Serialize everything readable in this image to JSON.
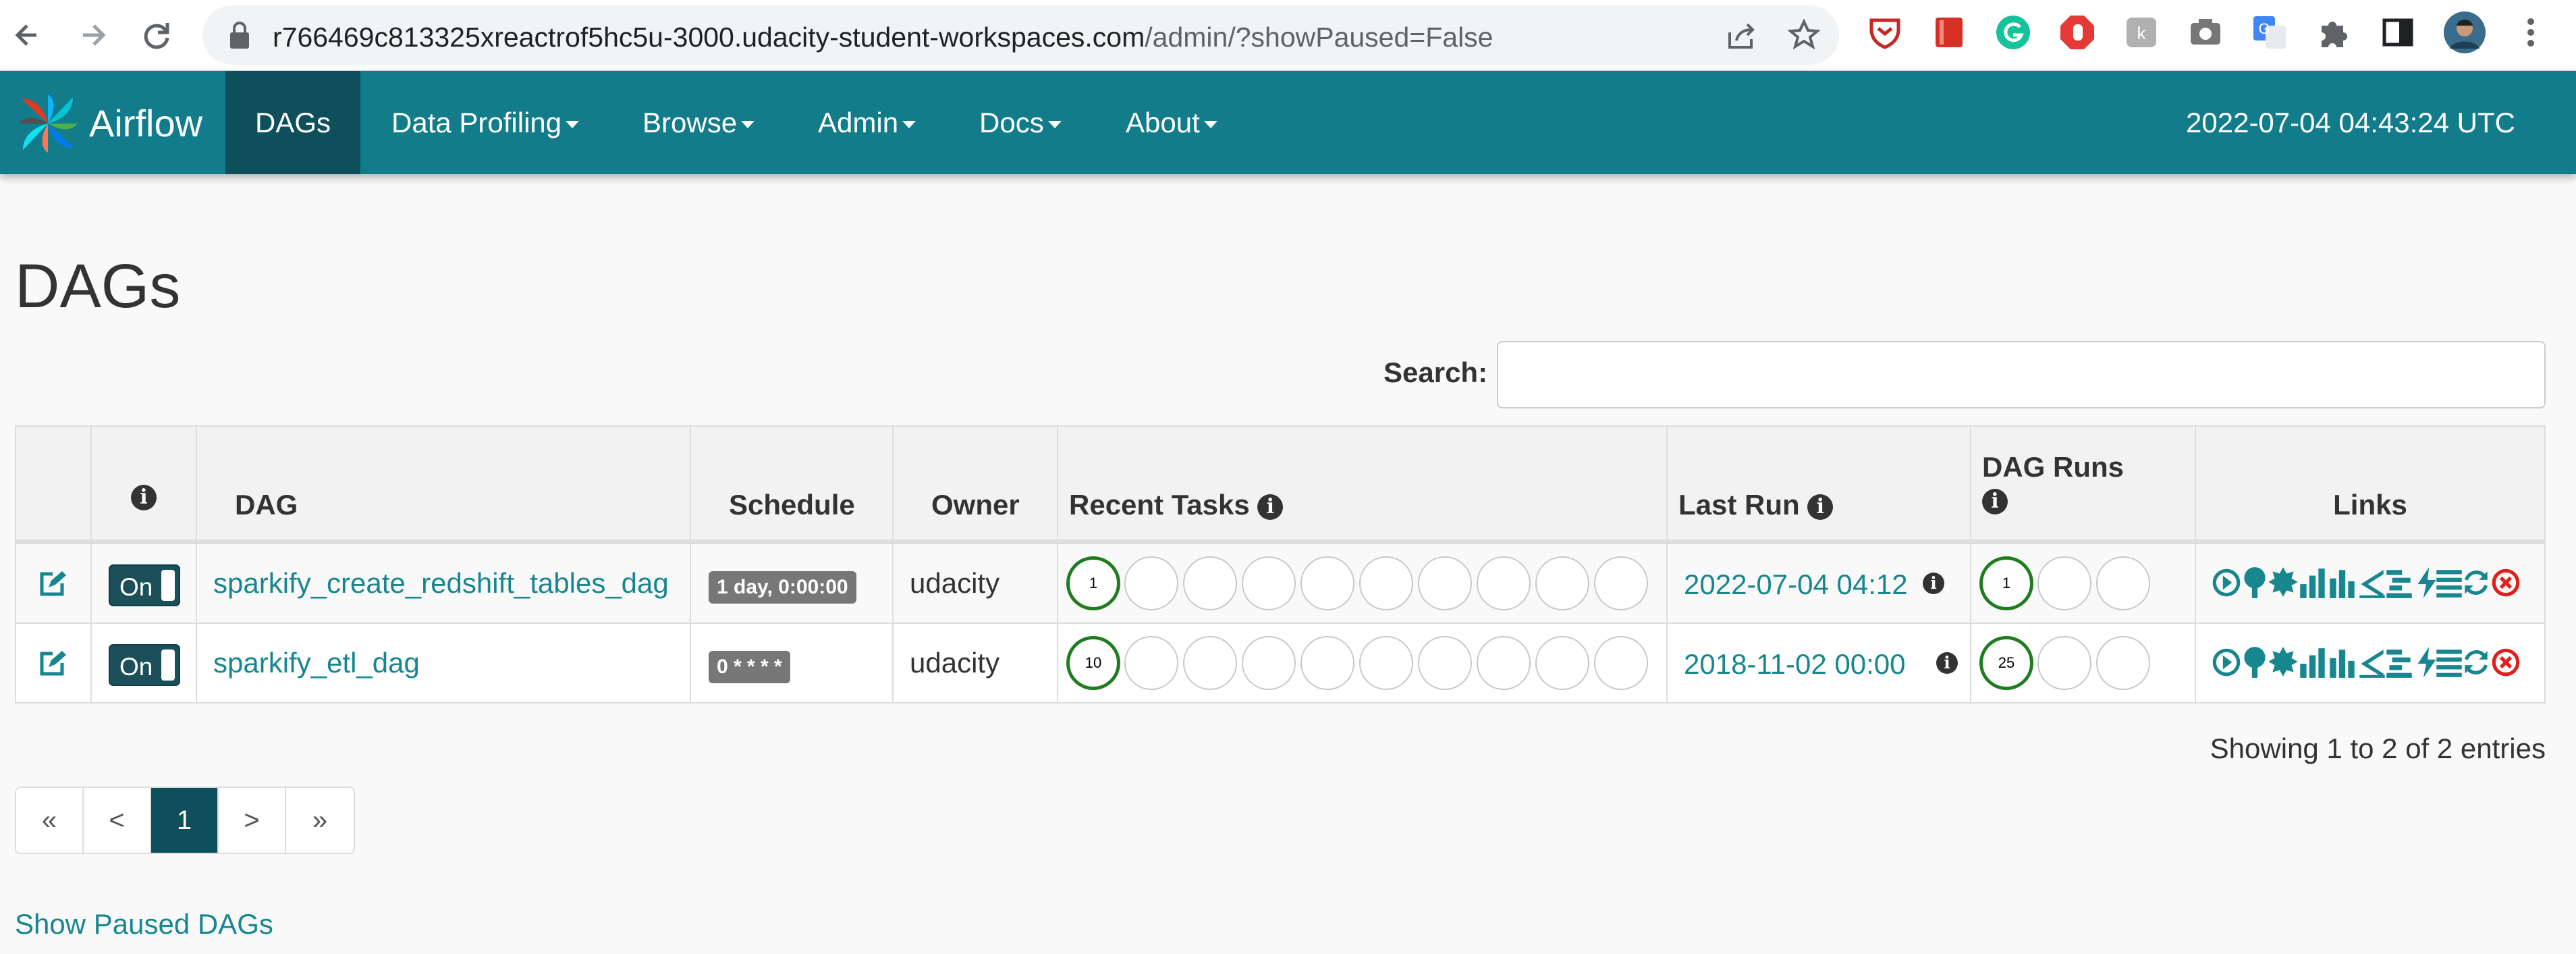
{
  "browser": {
    "url_host": "r766469c813325xreactrof5hc5u-3000.udacity-student-workspaces.com",
    "url_path": "/admin/?showPaused=False"
  },
  "navbar": {
    "brand": "Airflow",
    "items": [
      {
        "label": "DAGs",
        "active": true
      },
      {
        "label": "Data Profiling",
        "dropdown": true
      },
      {
        "label": "Browse",
        "dropdown": true
      },
      {
        "label": "Admin",
        "dropdown": true
      },
      {
        "label": "Docs",
        "dropdown": true
      },
      {
        "label": "About",
        "dropdown": true
      }
    ],
    "clock": "2022-07-04 04:43:24 UTC"
  },
  "page": {
    "title": "DAGs",
    "search_label": "Search:",
    "search_value": ""
  },
  "table": {
    "headers": {
      "dag": "DAG",
      "schedule": "Schedule",
      "owner": "Owner",
      "recent_tasks": "Recent Tasks",
      "last_run": "Last Run",
      "dag_runs": "DAG Runs",
      "links": "Links"
    },
    "rows": [
      {
        "toggle": "On",
        "dag": "sparkify_create_redshift_tables_dag",
        "schedule": "1 day, 0:00:00",
        "owner": "udacity",
        "recent_tasks_first": "1",
        "last_run": "2022-07-04 04:12",
        "dag_runs_first": "1"
      },
      {
        "toggle": "On",
        "dag": "sparkify_etl_dag",
        "schedule": "0 * * * *",
        "owner": "udacity",
        "recent_tasks_first": "10",
        "last_run": "2018-11-02 00:00",
        "dag_runs_first": "25"
      }
    ]
  },
  "footer": {
    "entries_info": "Showing 1 to 2 of 2 entries",
    "pager": [
      "«",
      "<",
      "1",
      ">",
      "»"
    ],
    "show_paused": "Show Paused DAGs"
  },
  "colors": {
    "navbar": "#137c8b",
    "active_nav": "#0d4f5a",
    "link": "#17868f",
    "success": "#1e7d1e"
  }
}
